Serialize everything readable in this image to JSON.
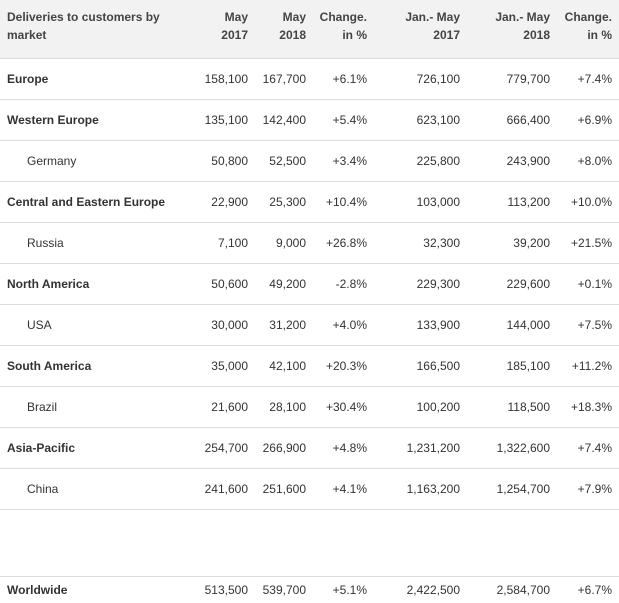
{
  "header": {
    "market": [
      "Deliveries to customers by",
      "market"
    ],
    "may2017": [
      "May",
      "2017"
    ],
    "may2018": [
      "May",
      "2018"
    ],
    "change1": [
      "Change.",
      "in %"
    ],
    "janmay2017": [
      "Jan.- May",
      "2017"
    ],
    "janmay2018": [
      "Jan.- May",
      "2018"
    ],
    "change2": [
      "Change.",
      "in %"
    ]
  },
  "rows": [
    {
      "market": "Europe",
      "may2017": "158,100",
      "may2018": "167,700",
      "change1": "+6.1%",
      "janmay2017": "726,100",
      "janmay2018": "779,700",
      "change2": "+7.4%"
    },
    {
      "market": "Western Europe",
      "may2017": "135,100",
      "may2018": "142,400",
      "change1": "+5.4%",
      "janmay2017": "623,100",
      "janmay2018": "666,400",
      "change2": "+6.9%"
    },
    {
      "market": "Germany",
      "may2017": "50,800",
      "may2018": "52,500",
      "change1": "+3.4%",
      "janmay2017": "225,800",
      "janmay2018": "243,900",
      "change2": "+8.0%"
    },
    {
      "market": "Central and Eastern Europe",
      "may2017": "22,900",
      "may2018": "25,300",
      "change1": "+10.4%",
      "janmay2017": "103,000",
      "janmay2018": "113,200",
      "change2": "+10.0%"
    },
    {
      "market": "Russia",
      "may2017": "7,100",
      "may2018": "9,000",
      "change1": "+26.8%",
      "janmay2017": "32,300",
      "janmay2018": "39,200",
      "change2": "+21.5%"
    },
    {
      "market": "North America",
      "may2017": "50,600",
      "may2018": "49,200",
      "change1": "-2.8%",
      "janmay2017": "229,300",
      "janmay2018": "229,600",
      "change2": "+0.1%"
    },
    {
      "market": "USA",
      "may2017": "30,000",
      "may2018": "31,200",
      "change1": "+4.0%",
      "janmay2017": "133,900",
      "janmay2018": "144,000",
      "change2": "+7.5%"
    },
    {
      "market": "South America",
      "may2017": "35,000",
      "may2018": "42,100",
      "change1": "+20.3%",
      "janmay2017": "166,500",
      "janmay2018": "185,100",
      "change2": "+11.2%"
    },
    {
      "market": "Brazil",
      "may2017": "21,600",
      "may2018": "28,100",
      "change1": "+30.4%",
      "janmay2017": "100,200",
      "janmay2018": "118,500",
      "change2": "+18.3%"
    },
    {
      "market": "Asia-Pacific",
      "may2017": "254,700",
      "may2018": "266,900",
      "change1": "+4.8%",
      "janmay2017": "1,231,200",
      "janmay2018": "1,322,600",
      "change2": "+7.4%"
    },
    {
      "market": "China",
      "may2017": "241,600",
      "may2018": "251,600",
      "change1": "+4.1%",
      "janmay2017": "1,163,200",
      "janmay2018": "1,254,700",
      "change2": "+7.9%"
    }
  ],
  "worldwide": {
    "market": "Worldwide",
    "may2017": "513,500",
    "may2018": "539,700",
    "change1": "+5.1%",
    "janmay2017": "2,422,500",
    "janmay2018": "2,584,700",
    "change2": "+6.7%"
  }
}
